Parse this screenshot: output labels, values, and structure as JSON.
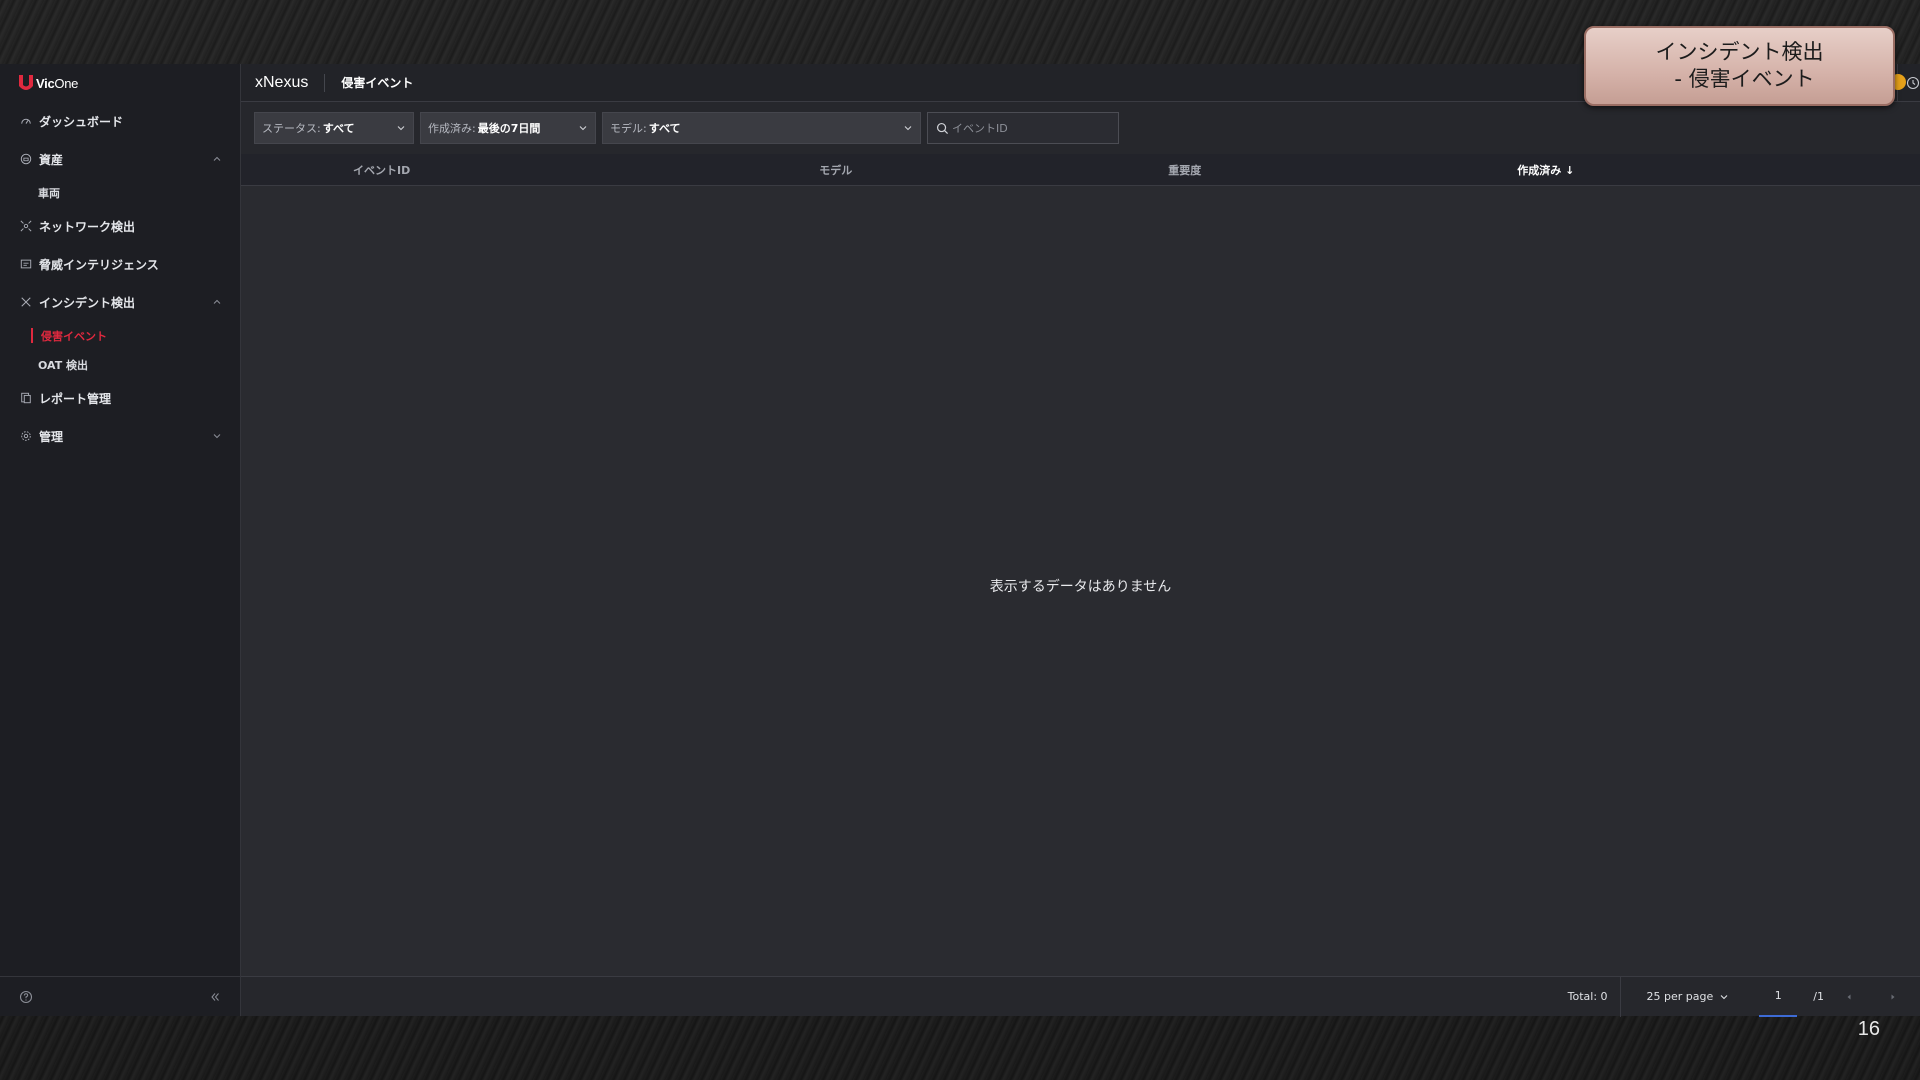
{
  "slide": {
    "number": "16"
  },
  "callout": {
    "line1": "インシデント検出",
    "line2": "- 侵害イベント"
  },
  "brand": {
    "logo_prefix": "Vic",
    "logo_suffix": "One",
    "accent": "#e0293f"
  },
  "sidebar": {
    "items": [
      {
        "label": "ダッシュボード",
        "icon": "dashboard-icon"
      },
      {
        "label": "資産",
        "icon": "asset-icon",
        "expanded": true,
        "children": [
          {
            "label": "車両"
          }
        ]
      },
      {
        "label": "ネットワーク検出",
        "icon": "network-icon"
      },
      {
        "label": "脅威インテリジェンス",
        "icon": "threat-intel-icon"
      },
      {
        "label": "インシデント検出",
        "icon": "incident-icon",
        "expanded": true,
        "children": [
          {
            "label": "侵害イベント",
            "active": true
          },
          {
            "label": "OAT 検出"
          }
        ]
      },
      {
        "label": "レポート管理",
        "icon": "report-icon"
      },
      {
        "label": "管理",
        "icon": "gear-icon",
        "expanded": false
      }
    ]
  },
  "header": {
    "app_name": "xNexus",
    "page_title": "侵害イベント"
  },
  "filters": {
    "status": {
      "key": "ステータス:",
      "value": "すべて"
    },
    "created": {
      "key": "作成済み:",
      "value": "最後の7日間"
    },
    "model": {
      "key": "モデル:",
      "value": "すべて"
    },
    "search_placeholder": "イベントID"
  },
  "table": {
    "columns": [
      "イベントID",
      "モデル",
      "重要度",
      "作成済み ↓"
    ],
    "sorted_column": "作成済み ↓",
    "rows": [],
    "empty_message": "表示するデータはありません"
  },
  "pagination": {
    "total": "Total: 0",
    "per_page": "25 per page",
    "current_page": "1",
    "total_pages": "/1"
  }
}
